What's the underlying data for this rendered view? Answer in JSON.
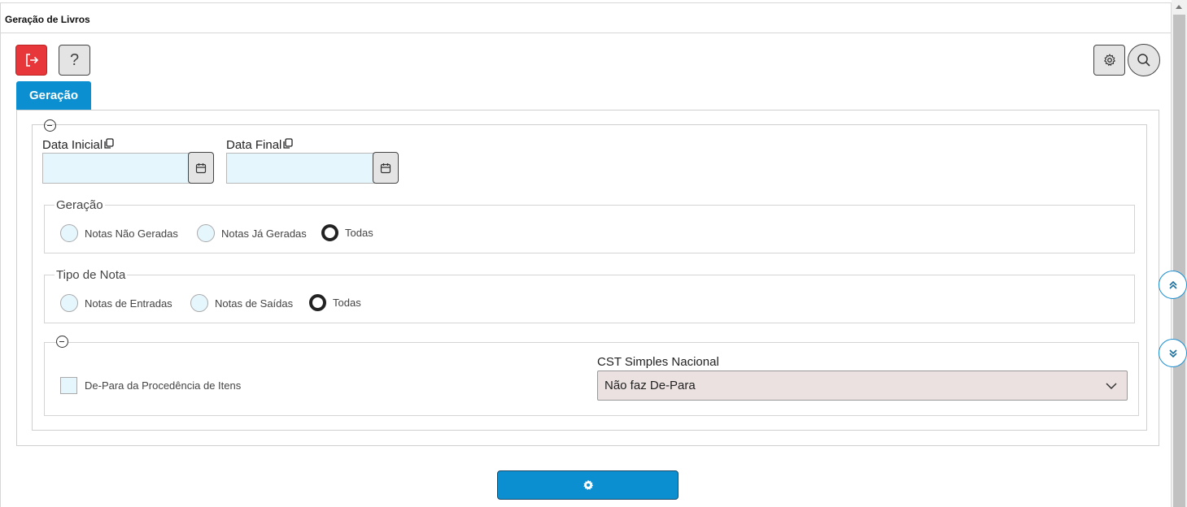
{
  "window": {
    "title": "Geração de Livros"
  },
  "toolbar": {
    "exit_icon": "exit-icon",
    "help_label": "?",
    "settings_icon": "gear-icon",
    "search_icon": "search-icon"
  },
  "tabs": [
    {
      "label": "Geração",
      "active": true
    }
  ],
  "dates": {
    "start": {
      "label": "Data Inicial",
      "value": ""
    },
    "end": {
      "label": "Data Final",
      "value": ""
    }
  },
  "geracao": {
    "legend": "Geração",
    "options": [
      {
        "label": "Notas Não Geradas",
        "checked": false
      },
      {
        "label": "Notas Já Geradas",
        "checked": false
      },
      {
        "label": "Todas",
        "checked": true
      }
    ]
  },
  "tipo_nota": {
    "legend": "Tipo de Nota",
    "options": [
      {
        "label": "Notas de Entradas",
        "checked": false
      },
      {
        "label": "Notas de Saídas",
        "checked": false
      },
      {
        "label": "Todas",
        "checked": true
      }
    ]
  },
  "advanced": {
    "checkbox_label": "De-Para da Procedência de Itens",
    "checkbox_checked": false,
    "cst_label": "CST Simples Nacional",
    "cst_value": "Não faz De-Para"
  },
  "side_nav": {
    "up_icon": "double-chevron-up-icon",
    "down_icon": "double-chevron-down-icon"
  },
  "run_button_icon": "gear-icon",
  "colors": {
    "accent": "#0b8fd0",
    "exit_button": "#e8373a",
    "input_bg": "#e6f6fd",
    "select_bg": "#ebe1e1"
  }
}
